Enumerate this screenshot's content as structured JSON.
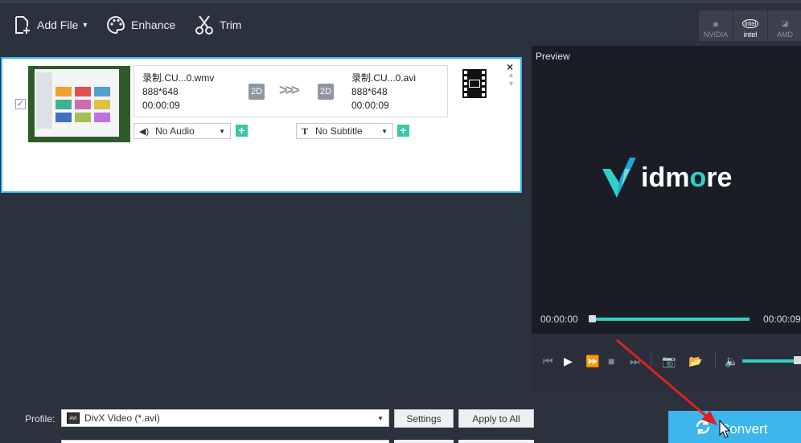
{
  "toolbar": {
    "add_file": "Add File",
    "enhance": "Enhance",
    "trim": "Trim"
  },
  "hardware": [
    {
      "label": "NVIDIA",
      "active": false
    },
    {
      "label": "intel",
      "logo": "intel",
      "active": true
    },
    {
      "label": "AMD",
      "active": false
    }
  ],
  "file": {
    "checked": true,
    "source": {
      "name": "录制.CU...0.wmv",
      "resolution": "888*648",
      "duration": "00:00:09"
    },
    "target": {
      "name": "录制.CU...0.avi",
      "resolution": "888*648",
      "duration": "00:00:09"
    },
    "badge_left": "2D",
    "badge_right": "2D",
    "arrows": ">>>",
    "audio": "No Audio",
    "subtitle": "No Subtitle",
    "close": "×"
  },
  "preview": {
    "title": "Preview",
    "logo_text_pre": "idm",
    "logo_text_o": "o",
    "logo_text_post": "re",
    "time_current": "00:00:00",
    "time_total": "00:00:09",
    "progress": 0.0,
    "volume": 0.9
  },
  "bottom": {
    "profile_label": "Profile:",
    "profile_value": "DivX Video (*.avi)",
    "profile_icon_text": "AVI",
    "settings": "Settings",
    "apply_all": "Apply to All",
    "convert": "Convert"
  },
  "colors": {
    "accent": "#3cb6ec",
    "teal": "#2fd0c5",
    "panel": "#2c313e",
    "annotation_arrow": "#e01f1f"
  }
}
